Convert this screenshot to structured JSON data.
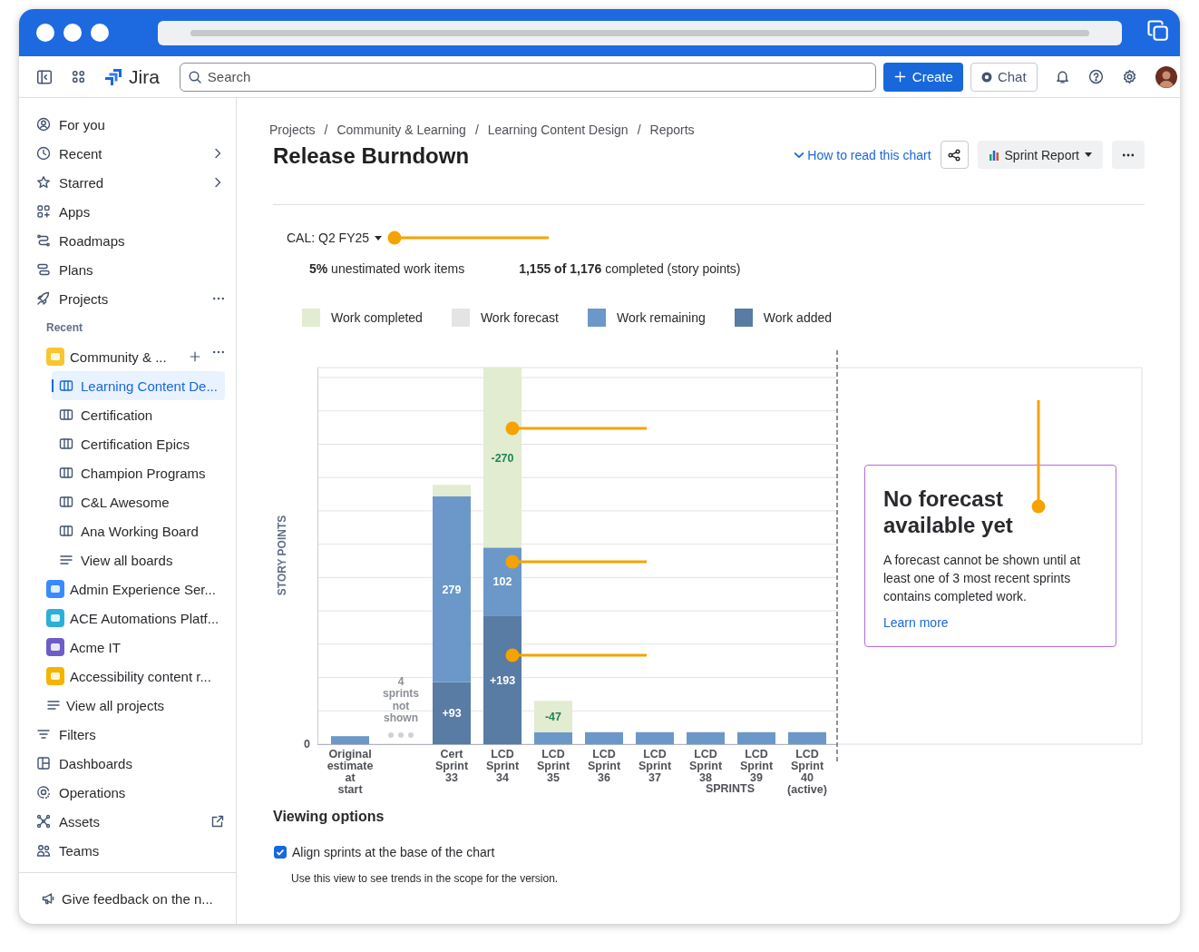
{
  "topnav": {
    "product": "Jira",
    "search": {
      "placeholder": "Search"
    },
    "buttons": [
      {
        "label": "Create",
        "kind": "primary"
      },
      {
        "label": "Chat",
        "kind": "secondary"
      }
    ]
  },
  "sidebar": {
    "nav": [
      {
        "label": "For you",
        "selected": false
      },
      {
        "label": "Recent",
        "kind": "submenu",
        "selected": false
      },
      {
        "label": "Starred",
        "kind": "submenu",
        "selected": false
      },
      {
        "label": "Apps",
        "selected": false
      },
      {
        "label": "Roadmaps",
        "selected": false
      },
      {
        "label": "Plans",
        "selected": false
      },
      {
        "label": "Projects",
        "kind": "more",
        "selected": false
      }
    ],
    "recent_heading": "Recent",
    "projects": [
      {
        "label": "Community & ...",
        "color": "#f8c630",
        "kind": "actions",
        "selected": false,
        "children": [
          {
            "label": "Learning Content De...",
            "kind": "board",
            "selected": true
          },
          {
            "label": "Certification",
            "kind": "board",
            "selected": false
          },
          {
            "label": "Certification Epics",
            "kind": "board",
            "selected": false
          },
          {
            "label": "Champion Programs",
            "kind": "board",
            "selected": false
          },
          {
            "label": "C&L Awesome",
            "kind": "board",
            "selected": false
          },
          {
            "label": "Ana Working Board",
            "kind": "board",
            "selected": false
          },
          {
            "label": "View all boards",
            "kind": "link",
            "selected": false
          }
        ]
      },
      {
        "label": "Admin Experience Ser...",
        "color": "#388bff",
        "selected": false
      },
      {
        "label": "ACE Automations Platf...",
        "color": "#2ab0d6",
        "selected": false
      },
      {
        "label": "Acme IT",
        "color": "#6e5dc6",
        "selected": false
      },
      {
        "label": "Accessibility content r...",
        "color": "#f5b400",
        "selected": false
      }
    ],
    "view_all_projects": "View all projects",
    "nav_bottom": [
      {
        "label": "Filters",
        "selected": false
      },
      {
        "label": "Dashboards",
        "selected": false
      },
      {
        "label": "Operations",
        "selected": false
      },
      {
        "label": "Assets",
        "kind": "external",
        "selected": false
      },
      {
        "label": "Teams",
        "selected": false
      }
    ],
    "feedback": "Give feedback on the n..."
  },
  "breadcrumb_separator": "/",
  "breadcrumbs": [
    "Projects",
    "Community & Learning",
    "Learning Content Design",
    "Reports"
  ],
  "title": "Release Burndown",
  "header_actions": {
    "help_link": "How to read this chart",
    "report_button": "Sprint Report"
  },
  "version_select": "CAL: Q2 FY25",
  "stats": [
    "**5%** unestimated work items",
    "**1,155 of 1,176** completed (story points)"
  ],
  "chart": {
    "chart_data": {
      "type": "bar",
      "stacked": true,
      "xlabel": "SPRINTS",
      "ylabel": "STORY POINTS",
      "annotations": [
        "-270",
        "-47"
      ],
      "categories": [
        "Original estimate at start",
        "Cert Sprint 33",
        "LCD Sprint 34",
        "LCD Sprint 35",
        "LCD Sprint 36",
        "LCD Sprint 37",
        "LCD Sprint 38",
        "LCD Sprint 39",
        "LCD Sprint 40 (active)"
      ],
      "series": [
        {
          "name": "Work completed",
          "color": "#e2ecd0",
          "values": [
            null,
            17,
            270,
            47,
            null,
            null,
            null,
            null,
            null
          ]
        },
        {
          "name": "Work forecast",
          "color": "#e4e4e4",
          "values": [
            null,
            null,
            null,
            null,
            null,
            null,
            null,
            null,
            null
          ]
        },
        {
          "name": "Work remaining",
          "color": "#6b98c9",
          "values": [
            12,
            279,
            102,
            18,
            18,
            18,
            18,
            18,
            18
          ],
          "value_labels": [
            null,
            "279",
            "102",
            null,
            null,
            null,
            null,
            null,
            null
          ]
        },
        {
          "name": "Work added",
          "color": "#587ca3",
          "values": [
            null,
            93,
            193,
            null,
            null,
            null,
            null,
            null,
            null
          ],
          "value_labels": [
            null,
            "+93",
            "+193",
            null,
            null,
            null,
            null,
            null,
            null
          ]
        }
      ]
    },
    "y_axis_origin_label": "0",
    "gap_label": "4 sprints not shown",
    "forecast_card": {
      "title": "No forecast available yet",
      "body": "A forecast cannot be shown until at least one of 3 most recent sprints contains completed work.",
      "link": "Learn more"
    }
  },
  "viewing_options": {
    "heading": "Viewing options",
    "options": [
      {
        "label": "Align sprints at the base of the chart",
        "checked": true
      }
    ],
    "help": "Use this view to see trends in the scope for the version."
  }
}
